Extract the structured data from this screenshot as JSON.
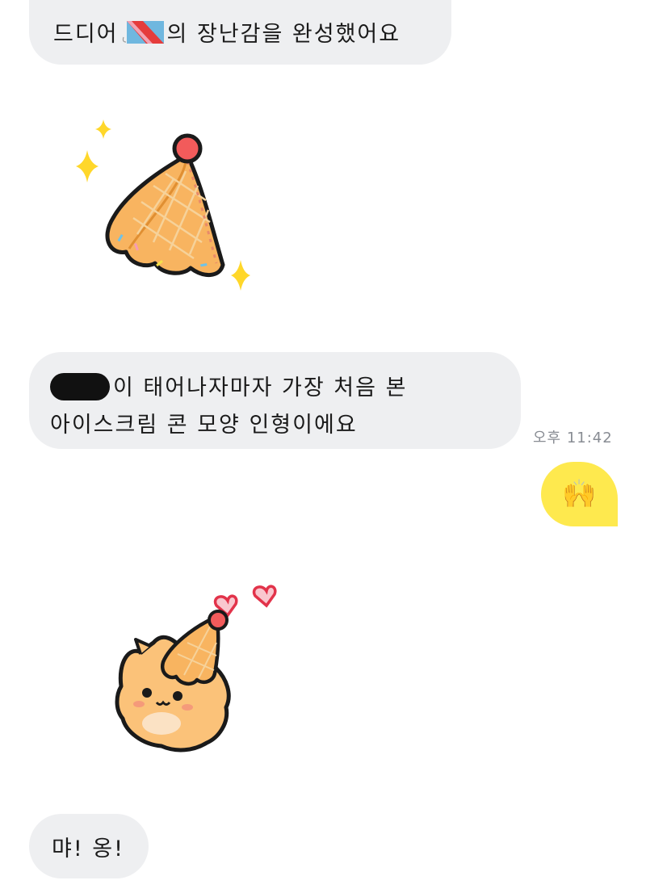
{
  "messages": {
    "first": {
      "before_sticker": "드디어",
      "after_sticker": "의 장난감을 완성했어요"
    },
    "second": {
      "line1_after_redaction": "이 태어나자마자 가장 처음 본",
      "line2": "아이스크림 콘 모양 인형이에요"
    },
    "timestamp": "오후 11:42",
    "my_reply_emoji": "🙌",
    "last": "먀! 옹!"
  },
  "colors": {
    "their_bubble": "#eeeff1",
    "my_bubble": "#fee94e",
    "timestamp": "#888c93"
  }
}
